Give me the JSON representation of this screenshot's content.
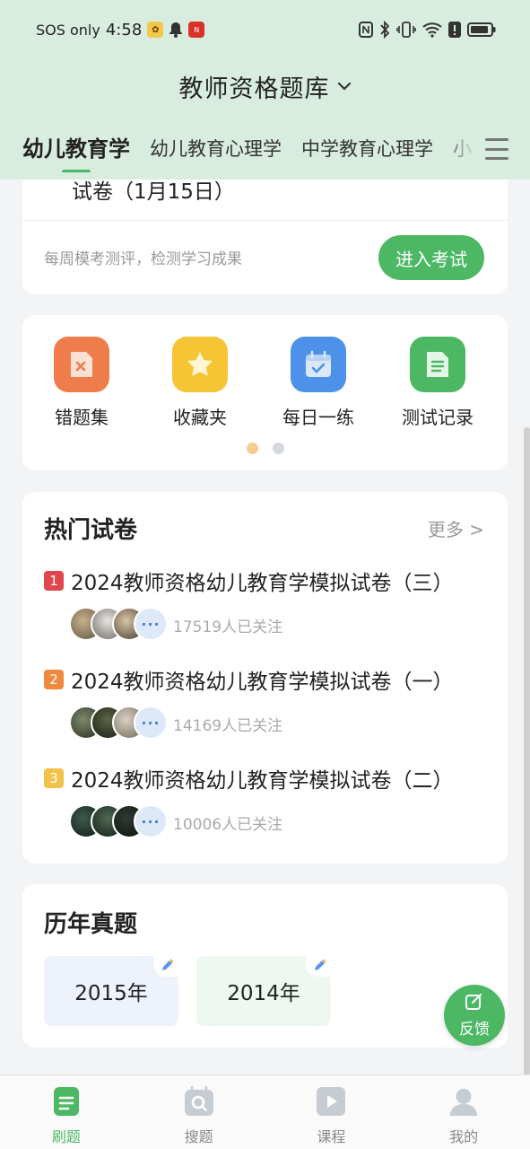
{
  "status_bar": {
    "carrier": "SOS only",
    "time": "4:58"
  },
  "header": {
    "title": "教师资格题库"
  },
  "tabs": [
    {
      "label": "幼儿教育学",
      "active": true
    },
    {
      "label": "幼儿教育心理学",
      "active": false
    },
    {
      "label": "中学教育心理学",
      "active": false
    },
    {
      "label": "小",
      "active": false
    }
  ],
  "mock_exam": {
    "title_partial": "试卷（1月15日）",
    "subtitle": "每周模考测评，检测学习成果",
    "enter_label": "进入考试"
  },
  "quick_actions": [
    {
      "label": "错题集",
      "icon": "wrong-questions-icon",
      "color": "#ef7d4b"
    },
    {
      "label": "收藏夹",
      "icon": "star-icon",
      "color": "#f5c535"
    },
    {
      "label": "每日一练",
      "icon": "calendar-check-icon",
      "color": "#4d92e8"
    },
    {
      "label": "测试记录",
      "icon": "document-icon",
      "color": "#4cb864"
    }
  ],
  "hot_papers": {
    "title": "热门试卷",
    "more_label": "更多 >",
    "items": [
      {
        "rank": "1",
        "rank_color": "#e0474c",
        "title": "2024教师资格幼儿教育学模拟试卷（三）",
        "followers": "17519人已关注"
      },
      {
        "rank": "2",
        "rank_color": "#ef8a3c",
        "title": "2024教师资格幼儿教育学模拟试卷（一）",
        "followers": "14169人已关注"
      },
      {
        "rank": "3",
        "rank_color": "#f2c14a",
        "title": "2024教师资格幼儿教育学模拟试卷（二）",
        "followers": "10006人已关注"
      }
    ],
    "more_avatars_symbol": "···"
  },
  "past_exams": {
    "title": "历年真题",
    "years": [
      {
        "label": "2015年",
        "bg": "#edf2fb"
      },
      {
        "label": "2014年",
        "bg": "#eef8f1"
      }
    ]
  },
  "feedback": {
    "label": "反馈"
  },
  "bottom_nav": [
    {
      "label": "刷题",
      "icon": "practice-icon",
      "active": true
    },
    {
      "label": "搜题",
      "icon": "search-question-icon",
      "active": false
    },
    {
      "label": "课程",
      "icon": "video-course-icon",
      "active": false
    },
    {
      "label": "我的",
      "icon": "profile-icon",
      "active": false
    }
  ],
  "colors": {
    "accent": "#4cb864",
    "header_bg": "#d8ede0"
  }
}
